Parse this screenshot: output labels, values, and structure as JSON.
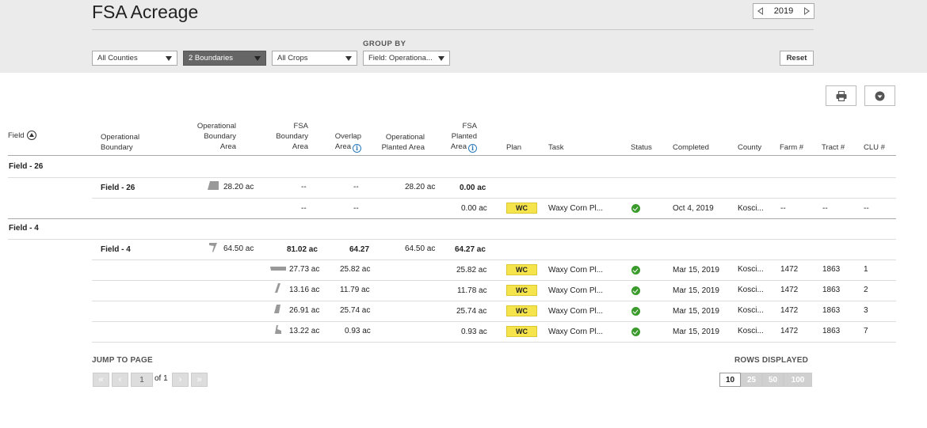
{
  "header": {
    "title": "FSA Acreage",
    "year": "2019",
    "group_by_label": "GROUP BY",
    "filters": {
      "counties": "All Counties",
      "boundaries": "2 Boundaries",
      "crops": "All Crops",
      "group_by": "Field: Operationa..."
    },
    "reset_label": "Reset"
  },
  "table": {
    "columns": {
      "field": "Field",
      "operational_boundary": [
        "Operational",
        "Boundary"
      ],
      "operational_boundary_area": [
        "Operational",
        "Boundary",
        "Area"
      ],
      "fsa_boundary_area": [
        "FSA",
        "Boundary",
        "Area"
      ],
      "overlap_area": [
        "Overlap",
        "Area"
      ],
      "operational_planted_area": [
        "Operational",
        "Planted Area"
      ],
      "fsa_planted_area": [
        "FSA",
        "Planted",
        "Area"
      ],
      "plan": "Plan",
      "task": "Task",
      "status": "Status",
      "completed": "Completed",
      "county": "County",
      "farm": "Farm #",
      "tract": "Tract #",
      "clu": "CLU #"
    },
    "groups": [
      {
        "label": "Field - 26",
        "summary": {
          "boundary": "Field - 26",
          "op_area": "28.20 ac",
          "fsa_area": "--",
          "overlap": "--",
          "op_planted": "28.20 ac",
          "fsa_planted": "0.00 ac"
        },
        "rows": [
          {
            "fsa_area": "--",
            "overlap": "--",
            "fsa_planted": "0.00 ac",
            "plan": "WC",
            "task": "Waxy Corn Pl...",
            "completed": "Oct 4, 2019",
            "county": "Kosci...",
            "farm": "--",
            "tract": "--",
            "clu": "--"
          }
        ]
      },
      {
        "label": "Field - 4",
        "summary": {
          "boundary": "Field - 4",
          "op_area": "64.50 ac",
          "fsa_area": "81.02 ac",
          "overlap": "64.27",
          "op_planted": "64.50 ac",
          "fsa_planted": "64.27 ac"
        },
        "rows": [
          {
            "fsa_area": "27.73 ac",
            "overlap": "25.82 ac",
            "fsa_planted": "25.82 ac",
            "plan": "WC",
            "task": "Waxy Corn Pl...",
            "completed": "Mar 15, 2019",
            "county": "Kosci...",
            "farm": "1472",
            "tract": "1863",
            "clu": "1"
          },
          {
            "fsa_area": "13.16 ac",
            "overlap": "11.79 ac",
            "fsa_planted": "11.78 ac",
            "plan": "WC",
            "task": "Waxy Corn Pl...",
            "completed": "Mar 15, 2019",
            "county": "Kosci...",
            "farm": "1472",
            "tract": "1863",
            "clu": "2"
          },
          {
            "fsa_area": "26.91 ac",
            "overlap": "25.74 ac",
            "fsa_planted": "25.74 ac",
            "plan": "WC",
            "task": "Waxy Corn Pl...",
            "completed": "Mar 15, 2019",
            "county": "Kosci...",
            "farm": "1472",
            "tract": "1863",
            "clu": "3"
          },
          {
            "fsa_area": "13.22 ac",
            "overlap": "0.93 ac",
            "fsa_planted": "0.93 ac",
            "plan": "WC",
            "task": "Waxy Corn Pl...",
            "completed": "Mar 15, 2019",
            "county": "Kosci...",
            "farm": "1472",
            "tract": "1863",
            "clu": "7"
          }
        ]
      }
    ]
  },
  "pagination": {
    "jump_label": "JUMP TO PAGE",
    "page": "1",
    "of_label": "of 1",
    "first": "«",
    "prev": "‹",
    "next": "›",
    "last": "»",
    "rows_label": "ROWS DISPLAYED",
    "rows_options": [
      "10",
      "25",
      "50",
      "100"
    ]
  },
  "colors": {
    "plan_badge": "#f5e44b",
    "status_ok": "#3a9a2c",
    "info": "#2a79b9"
  },
  "icons": [
    "print-icon",
    "download-icon",
    "sort-asc-icon",
    "info-icon",
    "check-circle-icon",
    "chevron-left-icon",
    "chevron-right-icon"
  ]
}
